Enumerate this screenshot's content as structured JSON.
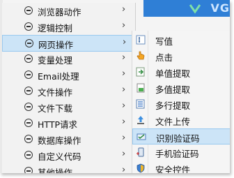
{
  "left_menu": {
    "items": [
      {
        "label": "浏览器动作"
      },
      {
        "label": "逻辑控制"
      },
      {
        "label": "网页操作",
        "active": true
      },
      {
        "label": "变量处理"
      },
      {
        "label": "Email处理"
      },
      {
        "label": "文件操作"
      },
      {
        "label": "文件下载"
      },
      {
        "label": "HTTP请求"
      },
      {
        "label": "数据库操作"
      },
      {
        "label": "自定义代码"
      },
      {
        "label": "其他操作"
      }
    ],
    "chevron": "›"
  },
  "banner": {
    "text": "VG"
  },
  "sub_menu": {
    "items": [
      {
        "label": "写值",
        "icon": "text-cursor-icon"
      },
      {
        "label": "点击",
        "icon": "hand-pointer-icon"
      },
      {
        "label": "单值提取",
        "icon": "extract-single-icon"
      },
      {
        "label": "多值提取",
        "icon": "extract-multi-icon"
      },
      {
        "label": "多行提取",
        "icon": "extract-rows-icon"
      },
      {
        "label": "文件上传",
        "icon": "upload-icon"
      },
      {
        "label": "识别验证码",
        "icon": "captcha-icon",
        "active": true
      },
      {
        "label": "手机验证码",
        "icon": "phone-code-icon"
      },
      {
        "label": "安全控件",
        "icon": "shield-icon"
      }
    ]
  },
  "colors": {
    "highlight_bg": "#cce4f7",
    "highlight_border": "#99c9ef",
    "banner": "#2f7fd6"
  }
}
